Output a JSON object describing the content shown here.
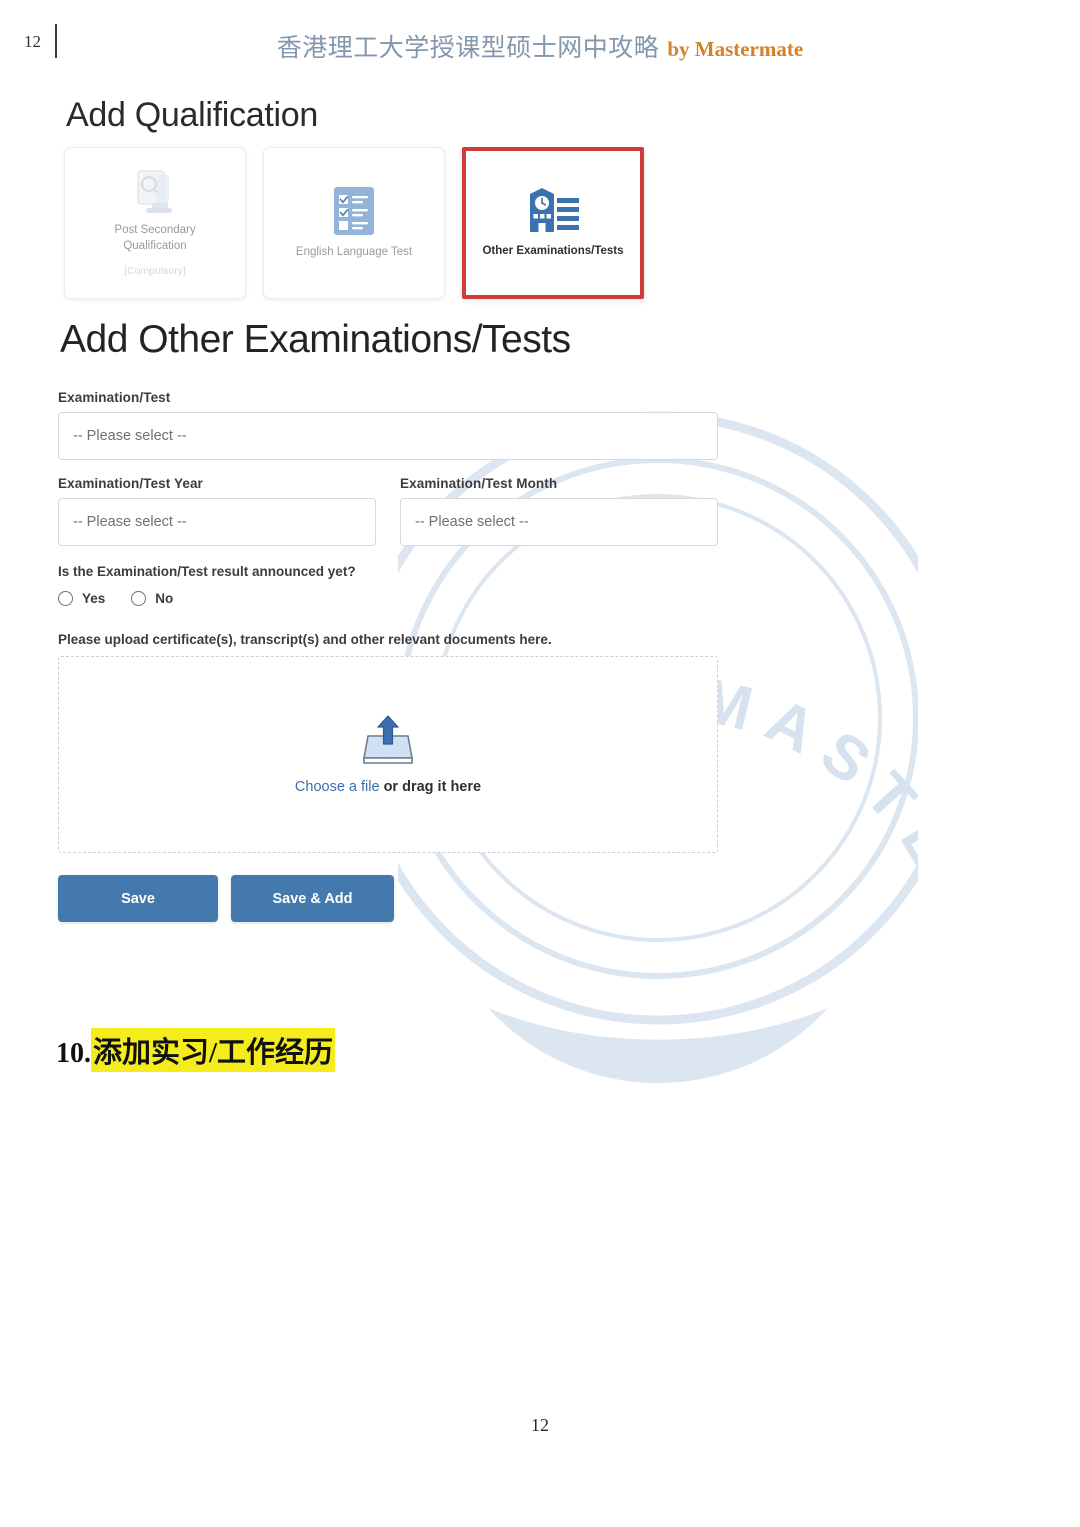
{
  "margin": {
    "page_marker": "12"
  },
  "header": {
    "title_cn": "香港理工大学授课型硕士网中攻略",
    "byline": "by Mastermate"
  },
  "watermark": {
    "text": "MASTERMATE",
    "color": "#dbe6f0"
  },
  "screenshot": {
    "section_heading": "Add Qualification",
    "cards": [
      {
        "label": "Post Secondary\nQualification",
        "label_line1": "Post Secondary",
        "label_line2": "Qualification",
        "sublabel": "[Compulsory]",
        "icon": "document-magnifier-icon",
        "state": "faded"
      },
      {
        "label": "English Language Test",
        "icon": "checklist-icon",
        "state": "normal"
      },
      {
        "label": "Other Examinations/Tests",
        "icon": "school-building-clock-icon",
        "state": "selected",
        "highlight_color": "#cf3b3b"
      }
    ],
    "form_heading": "Add Other Examinations/Tests",
    "fields": {
      "exam_test": {
        "label": "Examination/Test",
        "value": "-- Please select --"
      },
      "exam_year": {
        "label": "Examination/Test Year",
        "value": "-- Please select --"
      },
      "exam_month": {
        "label": "Examination/Test Month",
        "value": "-- Please select --"
      },
      "result_announced": {
        "question": "Is the Examination/Test result announced yet?",
        "options": [
          "Yes",
          "No"
        ],
        "option_yes": "Yes",
        "option_no": "No",
        "selected": ""
      },
      "upload": {
        "label": "Please upload certificate(s), transcript(s) and other relevant documents here.",
        "icon": "upload-tray-icon",
        "link_text": "Choose a file",
        "rest_text": " or drag it here"
      }
    },
    "buttons": {
      "save": "Save",
      "save_and_add": "Save & Add",
      "color": "#4379ad"
    }
  },
  "step": {
    "index": "10.",
    "text": "添加实习/工作经历",
    "highlight_color": "#f5ec1d"
  },
  "footer": {
    "page_number": "12"
  }
}
